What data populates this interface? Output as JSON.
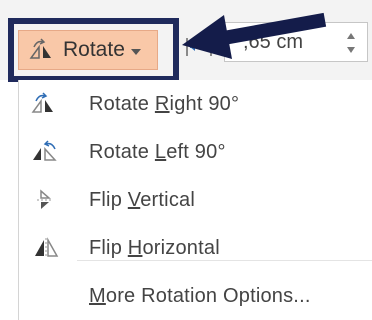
{
  "toolbar": {
    "rotate_button": {
      "label": "Rotate",
      "icon": "rotate-icon",
      "state": "pressed"
    },
    "size_field": {
      "value": ",65 cm",
      "icon": "width-arrows-icon"
    }
  },
  "menu": {
    "items": [
      {
        "pre": "Rotate ",
        "key": "R",
        "post": "ight 90°",
        "icon": "rotate-right-icon"
      },
      {
        "pre": "Rotate ",
        "key": "L",
        "post": "eft 90°",
        "icon": "rotate-left-icon"
      },
      {
        "pre": "Flip ",
        "key": "V",
        "post": "ertical",
        "icon": "flip-vertical-icon"
      },
      {
        "pre": "Flip ",
        "key": "H",
        "post": "orizontal",
        "icon": "flip-horizontal-icon"
      },
      {
        "pre": "",
        "key": "M",
        "post": "ore Rotation Options...",
        "icon": ""
      }
    ]
  },
  "colors": {
    "annotation_frame": "#1f2a5c",
    "annotation_arrow": "#141c4a",
    "button_pressed_bg": "#f9c8a8"
  }
}
